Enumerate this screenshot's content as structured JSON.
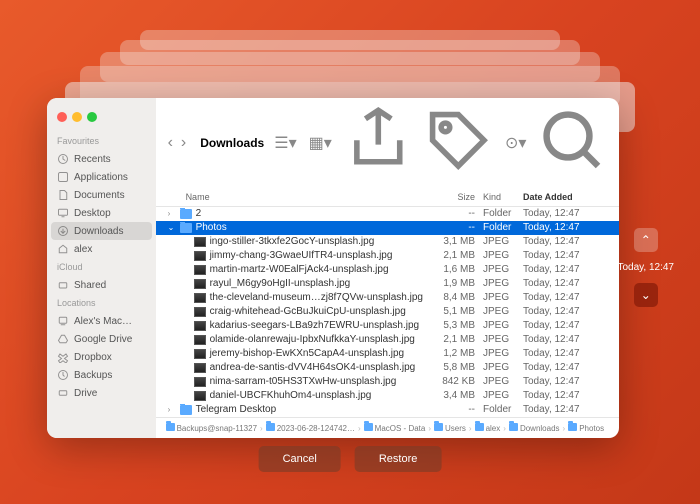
{
  "window_title": "Downloads",
  "sidebar": {
    "sections": [
      {
        "header": "Favourites",
        "items": [
          {
            "label": "Recents",
            "icon": "clock"
          },
          {
            "label": "Applications",
            "icon": "app"
          },
          {
            "label": "Documents",
            "icon": "doc"
          },
          {
            "label": "Desktop",
            "icon": "desktop"
          },
          {
            "label": "Downloads",
            "icon": "download",
            "active": true
          },
          {
            "label": "alex",
            "icon": "home"
          }
        ]
      },
      {
        "header": "iCloud",
        "items": [
          {
            "label": "Shared",
            "icon": "shared"
          }
        ]
      },
      {
        "header": "Locations",
        "items": [
          {
            "label": "Alex's Mac…",
            "icon": "mac"
          },
          {
            "label": "Google Drive",
            "icon": "gdrive"
          },
          {
            "label": "Dropbox",
            "icon": "dropbox"
          },
          {
            "label": "Backups",
            "icon": "backup"
          },
          {
            "label": "Drive",
            "icon": "drive"
          }
        ]
      }
    ]
  },
  "columns": {
    "name": "Name",
    "size": "Size",
    "kind": "Kind",
    "date": "Date Added"
  },
  "files": [
    {
      "name": "2",
      "size": "--",
      "kind": "Folder",
      "date": "Today, 12:47",
      "type": "folder",
      "depth": 0,
      "expanded": false
    },
    {
      "name": "Photos",
      "size": "--",
      "kind": "Folder",
      "date": "Today, 12:47",
      "type": "folder",
      "depth": 0,
      "expanded": true,
      "selected": true
    },
    {
      "name": "ingo-stiller-3tkxfe2GocY-unsplash.jpg",
      "size": "3,1 MB",
      "kind": "JPEG",
      "date": "Today, 12:47",
      "type": "image",
      "depth": 1
    },
    {
      "name": "jimmy-chang-3GwaeUIfTR4-unsplash.jpg",
      "size": "2,1 MB",
      "kind": "JPEG",
      "date": "Today, 12:47",
      "type": "image",
      "depth": 1
    },
    {
      "name": "martin-martz-W0EalFjAck4-unsplash.jpg",
      "size": "1,6 MB",
      "kind": "JPEG",
      "date": "Today, 12:47",
      "type": "image",
      "depth": 1
    },
    {
      "name": "rayul_M6gy9oHgII-unsplash.jpg",
      "size": "1,9 MB",
      "kind": "JPEG",
      "date": "Today, 12:47",
      "type": "image",
      "depth": 1
    },
    {
      "name": "the-cleveland-museum…zj8f7QVw-unsplash.jpg",
      "size": "8,4 MB",
      "kind": "JPEG",
      "date": "Today, 12:47",
      "type": "image",
      "depth": 1
    },
    {
      "name": "craig-whitehead-GcBuJkuiCpU-unsplash.jpg",
      "size": "5,1 MB",
      "kind": "JPEG",
      "date": "Today, 12:47",
      "type": "image",
      "depth": 1
    },
    {
      "name": "kadarius-seegars-LBa9zh7EWRU-unsplash.jpg",
      "size": "5,3 MB",
      "kind": "JPEG",
      "date": "Today, 12:47",
      "type": "image",
      "depth": 1
    },
    {
      "name": "olamide-olanrewaju-IpbxNufkkaY-unsplash.jpg",
      "size": "2,1 MB",
      "kind": "JPEG",
      "date": "Today, 12:47",
      "type": "image",
      "depth": 1
    },
    {
      "name": "jeremy-bishop-EwKXn5CapA4-unsplash.jpg",
      "size": "1,2 MB",
      "kind": "JPEG",
      "date": "Today, 12:47",
      "type": "image",
      "depth": 1
    },
    {
      "name": "andrea-de-santis-dVV4H64sOK4-unsplash.jpg",
      "size": "5,8 MB",
      "kind": "JPEG",
      "date": "Today, 12:47",
      "type": "image",
      "depth": 1
    },
    {
      "name": "nima-sarram-t05HS3TXwHw-unsplash.jpg",
      "size": "842 KB",
      "kind": "JPEG",
      "date": "Today, 12:47",
      "type": "image",
      "depth": 1
    },
    {
      "name": "daniel-UBCFKhuhOm4-unsplash.jpg",
      "size": "3,4 MB",
      "kind": "JPEG",
      "date": "Today, 12:47",
      "type": "image",
      "depth": 1
    },
    {
      "name": "Telegram Desktop",
      "size": "--",
      "kind": "Folder",
      "date": "Today, 12:47",
      "type": "folder",
      "depth": 0,
      "expanded": false
    }
  ],
  "path": [
    "Backups@snap-11327",
    "2023-06-28-124742…",
    "MacOS - Data",
    "Users",
    "alex",
    "Downloads",
    "Photos"
  ],
  "buttons": {
    "cancel": "Cancel",
    "restore": "Restore"
  },
  "snapshot_label": "Today, 12:47"
}
